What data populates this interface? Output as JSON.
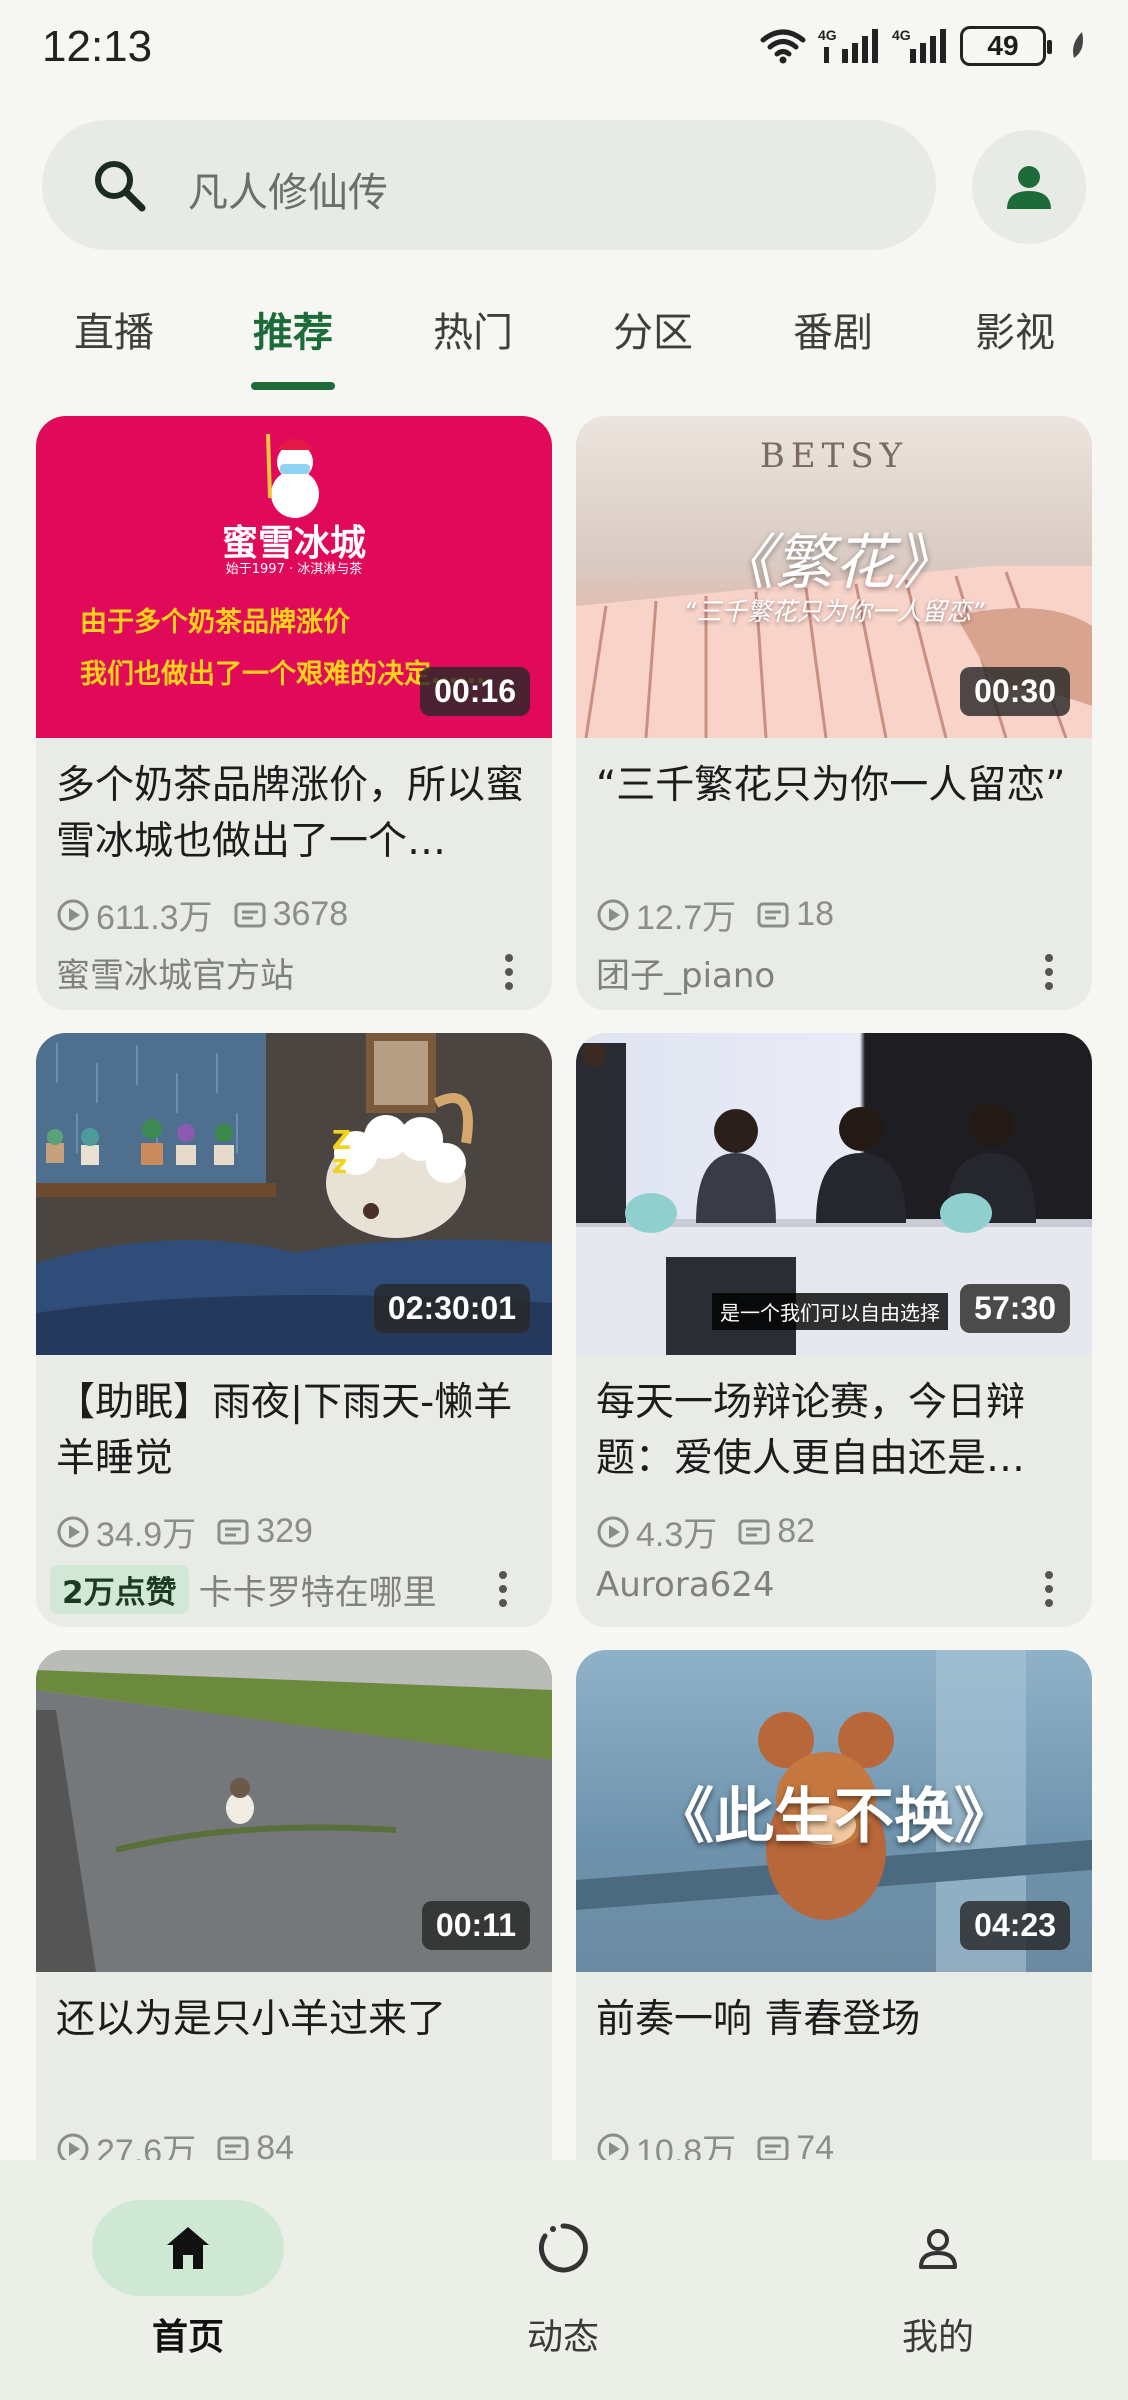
{
  "status_bar": {
    "time": "12:13",
    "battery": "49",
    "net1": "4G",
    "net2": "4G"
  },
  "search": {
    "placeholder": "凡人修仙传"
  },
  "tabs": [
    {
      "label": "直播"
    },
    {
      "label": "推荐",
      "active": true
    },
    {
      "label": "热门"
    },
    {
      "label": "分区"
    },
    {
      "label": "番剧"
    },
    {
      "label": "影视"
    }
  ],
  "cards": [
    {
      "duration": "00:16",
      "title": "多个奶茶品牌涨价，所以蜜雪冰城也做出了一个…",
      "views": "611.3万",
      "danmaku": "3678",
      "author": "蜜雪冰城官方站",
      "thumb_texts": {
        "brand": "蜜雪冰城",
        "slogan": "始于1997 · 冰淇淋与茶",
        "line1": "由于多个奶茶品牌涨价",
        "line2": "我们也做出了一个艰难的决定……"
      }
    },
    {
      "duration": "00:30",
      "title": "“三千繁花只为你一人留恋”",
      "views": "12.7万",
      "danmaku": "18",
      "author": "团子_piano",
      "thumb_texts": {
        "brand": "BETSY",
        "big": "《繁花》",
        "sub": "“三千繁花只为你一人留恋”"
      }
    },
    {
      "duration": "02:30:01",
      "title": "【助眠】雨夜|下雨天-懒羊羊睡觉",
      "views": "34.9万",
      "danmaku": "329",
      "author": "卡卡罗特在哪里",
      "badge": "2万点赞",
      "thumb_texts": {
        "zz": "Z z"
      }
    },
    {
      "duration": "57:30",
      "title": "每天一场辩论赛，今日辩题：爱使人更自由还是…",
      "views": "4.3万",
      "danmaku": "82",
      "author": "Aurora624",
      "thumb_texts": {
        "caption": "是一个我们可以自由选择"
      }
    },
    {
      "duration": "00:11",
      "title": "还以为是只小羊过来了",
      "views": "27.6万",
      "danmaku": "84",
      "author": ""
    },
    {
      "duration": "04:23",
      "title": "前奏一响 青春登场",
      "views": "10.8万",
      "danmaku": "74",
      "author": "",
      "thumb_texts": {
        "big": "《此生不换》"
      }
    }
  ],
  "bottom_nav": [
    {
      "label": "首页",
      "icon": "home-icon",
      "active": true
    },
    {
      "label": "动态",
      "icon": "dynamic-icon"
    },
    {
      "label": "我的",
      "icon": "profile-icon"
    }
  ],
  "colors": {
    "accent": "#1e6b3a",
    "background": "#f6f7f3",
    "card": "#e9ebe6"
  }
}
